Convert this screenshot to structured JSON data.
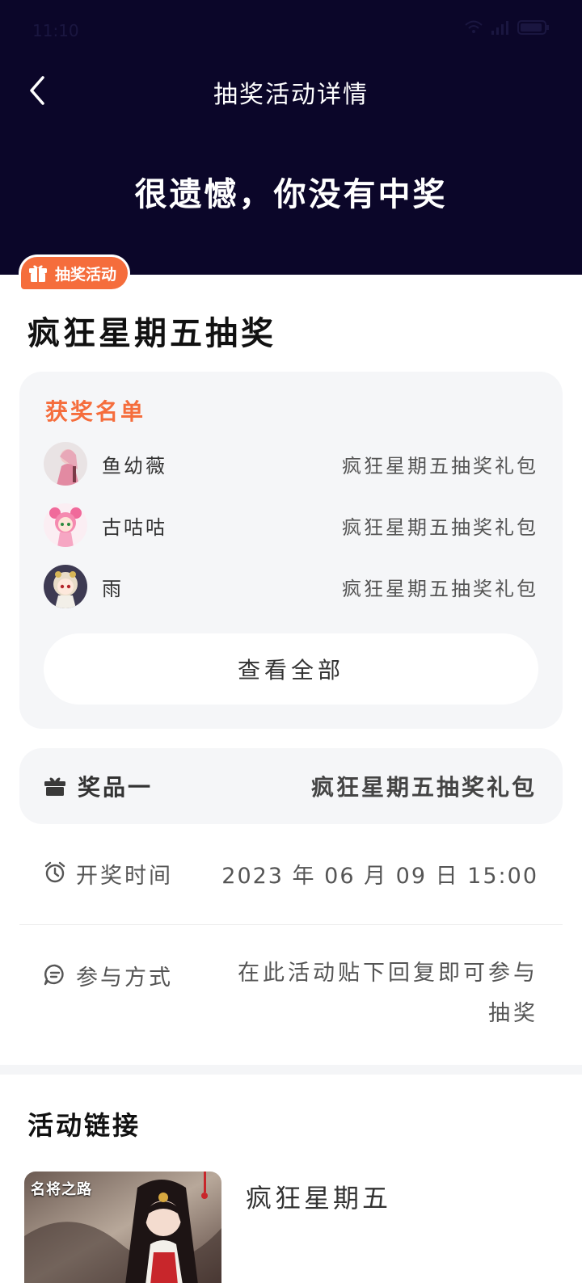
{
  "status_bar": {
    "time": "11:10",
    "icons": [
      "wifi-icon",
      "signal-icon",
      "battery-icon"
    ]
  },
  "header": {
    "back_icon": "chevron-left-icon",
    "title": "抽奖活动详情",
    "result": "很遗憾，你没有中奖"
  },
  "tag": {
    "icon": "gift-icon",
    "label": "抽奖活动"
  },
  "activity": {
    "title": "疯狂星期五抽奖"
  },
  "winners": {
    "title": "获奖名单",
    "items": [
      {
        "name": "鱼幼薇",
        "prize": "疯狂星期五抽奖礼包"
      },
      {
        "name": "古咕咕",
        "prize": "疯狂星期五抽奖礼包"
      },
      {
        "name": "雨",
        "prize": "疯狂星期五抽奖礼包"
      }
    ],
    "view_all": "查看全部"
  },
  "prize": {
    "icon": "gift-icon",
    "label": "奖品一",
    "value": "疯狂星期五抽奖礼包"
  },
  "info": {
    "draw_time_label": "开奖时间",
    "draw_time_value": "2023 年 06 月 09 日 15:00",
    "participate_label": "参与方式",
    "participate_value": "在此活动贴下回复即可参与抽奖"
  },
  "links": {
    "title": "活动链接",
    "items": [
      {
        "title": "疯狂星期五",
        "thumb_caption": "名将之路"
      }
    ]
  },
  "colors": {
    "header_bg": "#0b0629",
    "accent": "#f56d3c",
    "card_bg": "#f5f6f8"
  }
}
